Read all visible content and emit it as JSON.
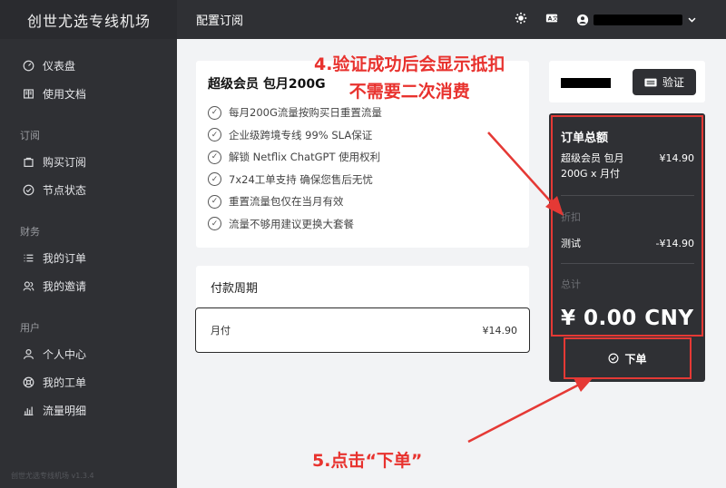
{
  "app": {
    "name": "创世尤选专线机场",
    "version": "创世尤选专线机场 v1.3.4"
  },
  "header": {
    "title": "配置订阅",
    "settings_icon": "gear-icon",
    "translate_icon": "translate-icon",
    "user_icon": "user-icon"
  },
  "sidebar": {
    "top_items": [
      {
        "label": "仪表盘",
        "icon": "dashboard-icon"
      },
      {
        "label": "使用文档",
        "icon": "book-icon"
      }
    ],
    "groups": [
      {
        "title": "订阅",
        "items": [
          {
            "label": "购买订阅",
            "icon": "bag-icon"
          },
          {
            "label": "节点状态",
            "icon": "check-circle-icon"
          }
        ]
      },
      {
        "title": "财务",
        "items": [
          {
            "label": "我的订单",
            "icon": "list-icon"
          },
          {
            "label": "我的邀请",
            "icon": "users-icon"
          }
        ]
      },
      {
        "title": "用户",
        "items": [
          {
            "label": "个人中心",
            "icon": "user-icon"
          },
          {
            "label": "我的工单",
            "icon": "support-icon"
          },
          {
            "label": "流量明细",
            "icon": "bar-chart-icon"
          }
        ]
      }
    ]
  },
  "plan": {
    "title": "超级会员 包月200G",
    "features": [
      "每月200G流量按购买日重置流量",
      "企业级跨境专线 99% SLA保证",
      "解锁 Netflix ChatGPT 使用权利",
      "7x24工单支持 确保您售后无忧",
      "重置流量包仅在当月有效",
      "流量不够用建议更换大套餐"
    ]
  },
  "period": {
    "title": "付款周期",
    "option_label": "月付",
    "option_price": "¥14.90"
  },
  "coupon": {
    "verify_label": "验证"
  },
  "summary": {
    "title": "订单总额",
    "item_name_line1": "超级会员 包月",
    "item_name_line2": "200G x 月付",
    "item_price": "¥14.90",
    "discount_label": "折扣",
    "coupon_name": "测试",
    "coupon_value": "-¥14.90",
    "total_label": "总计",
    "total_value": "¥ 0.00 CNY",
    "order_label": "下单"
  },
  "annotations": {
    "step4_line1": "4.验证成功后会显示抵扣",
    "step4_line2": "不需要二次消费",
    "step5": "5.点击“下单”",
    "color": "#e53935"
  }
}
